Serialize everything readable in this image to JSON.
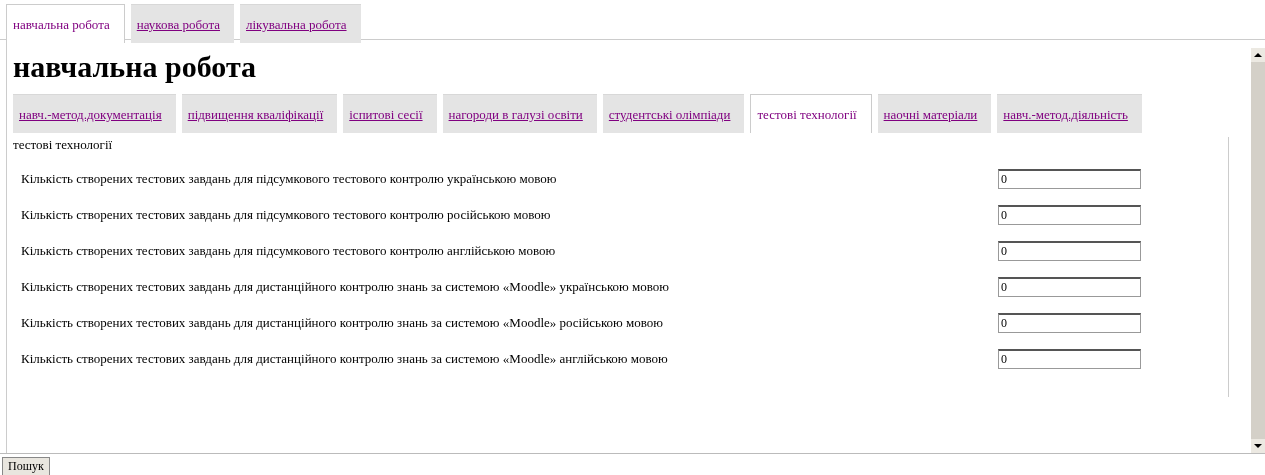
{
  "top_tabs": [
    {
      "label": "навчальна робота",
      "selected": true
    },
    {
      "label": "наукова робота",
      "selected": false
    },
    {
      "label": "лікувальна робота",
      "selected": false
    }
  ],
  "heading": "навчальна робота",
  "sub_tabs": [
    {
      "label": "навч.-метод.документація",
      "selected": false
    },
    {
      "label": "підвищення кваліфікації",
      "selected": false
    },
    {
      "label": "іспитові сесії",
      "selected": false
    },
    {
      "label": "нагороди в галузі освіти",
      "selected": false
    },
    {
      "label": "студентські олімпіади",
      "selected": false
    },
    {
      "label": "тестові технології",
      "selected": true
    },
    {
      "label": "наочні матеріали",
      "selected": false
    },
    {
      "label": "навч.-метод.діяльність",
      "selected": false
    }
  ],
  "panel": {
    "title": "тестові технології",
    "rows": [
      {
        "label": "Кількість створених тестових завдань для підсумкового тестового контролю українською мовою",
        "value": "0"
      },
      {
        "label": "Кількість створених тестових завдань для підсумкового тестового контролю російською мовою",
        "value": "0"
      },
      {
        "label": "Кількість створених тестових завдань для підсумкового тестового контролю англійською мовою",
        "value": "0"
      },
      {
        "label": "Кількість створених тестових завдань для дистанційного контролю знань за системою «Moodle» українською мовою",
        "value": "0"
      },
      {
        "label": "Кількість створених тестових завдань для дистанційного контролю знань за системою «Moodle» російською мовою",
        "value": "0"
      },
      {
        "label": "Кількість створених тестових завдань для дистанційного контролю знань за системою «Moodle» англійською мовою",
        "value": "0"
      }
    ]
  },
  "button": "Пошук"
}
